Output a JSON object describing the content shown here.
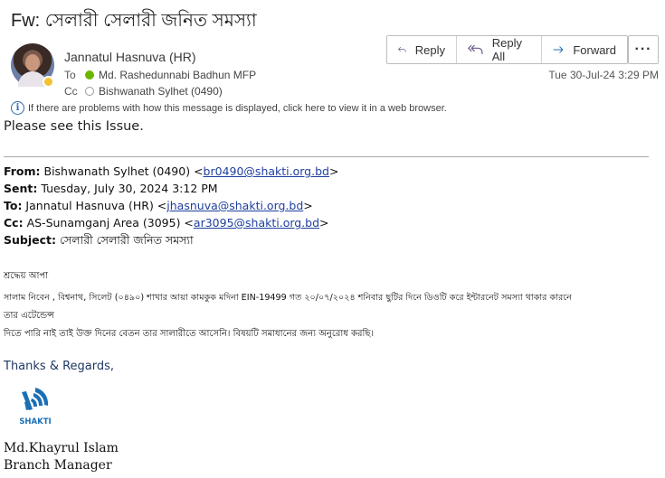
{
  "message": {
    "subject": "Fw: সেলারী সেলারী জনিত সমস্যা",
    "sender": "Jannatul Hasnuva (HR)",
    "to_label": "To",
    "to": "Md. Rashedunnabi Badhun MFP",
    "cc_label": "Cc",
    "cc": "Bishwanath Sylhet (0490)",
    "datetime": "Tue 30-Jul-24 3:29 PM"
  },
  "toolbar": {
    "reply": "Reply",
    "reply_all": "Reply All",
    "forward": "Forward",
    "more": "···"
  },
  "info_bar": "If there are problems with how this message is displayed, click here to view it in a web browser.",
  "body": {
    "greeting": "Please see this Issue.",
    "forward_header": {
      "from_label": "From:",
      "from_name": " Bishwanath Sylhet (0490) <",
      "from_email": "br0490@shakti.org.bd",
      "from_end": ">",
      "sent_label": "Sent:",
      "sent": " Tuesday, July 30, 2024 3:12 PM",
      "to_label": "To:",
      "to_name": " Jannatul Hasnuva (HR) <",
      "to_email": "jhasnuva@shakti.org.bd",
      "to_end": ">",
      "cc_label": "Cc:",
      "cc_name": " AS-Sunamganj Area (3095) <",
      "cc_email": "ar3095@shakti.org.bd",
      "cc_end": ">",
      "subject_label": "Subject:",
      "subject": " সেলারী  সেলারী  জনিত  সমস্যা"
    },
    "salutation": "শ্রদ্ধেয় আপা",
    "line1": "সালাম নিবেন , বিশ্বনাথ, সিলেট (০৪৯০) শাখার  আয়া কামকুক মদিনা   EIN-19499  গত ২০/০৭/২০২৪ শনিবার ছুটির দিনে ডিওটি করে ইন্টারনেট সমস্যা থাকার কারনে",
    "line2": "তার এটেন্ডেন্স",
    "line3": "দিতে পারি নাই তাই উক্ত দিনের বেতন তার সালারীতে আসেনি। বিষয়টি সমাধানের জন্য অনুরোধ করছি।",
    "thanks": "Thanks & Regards,",
    "logo_text": "SHAKTI",
    "sig_name": "Md.Khayrul Islam",
    "sig_title": "Branch Manager"
  },
  "colors": {
    "accent": "#1f3864",
    "link": "#1f3fa0",
    "presence_away": "#f2c230",
    "presence_available": "#6bb700",
    "logo_blue": "#1b6fb5"
  }
}
